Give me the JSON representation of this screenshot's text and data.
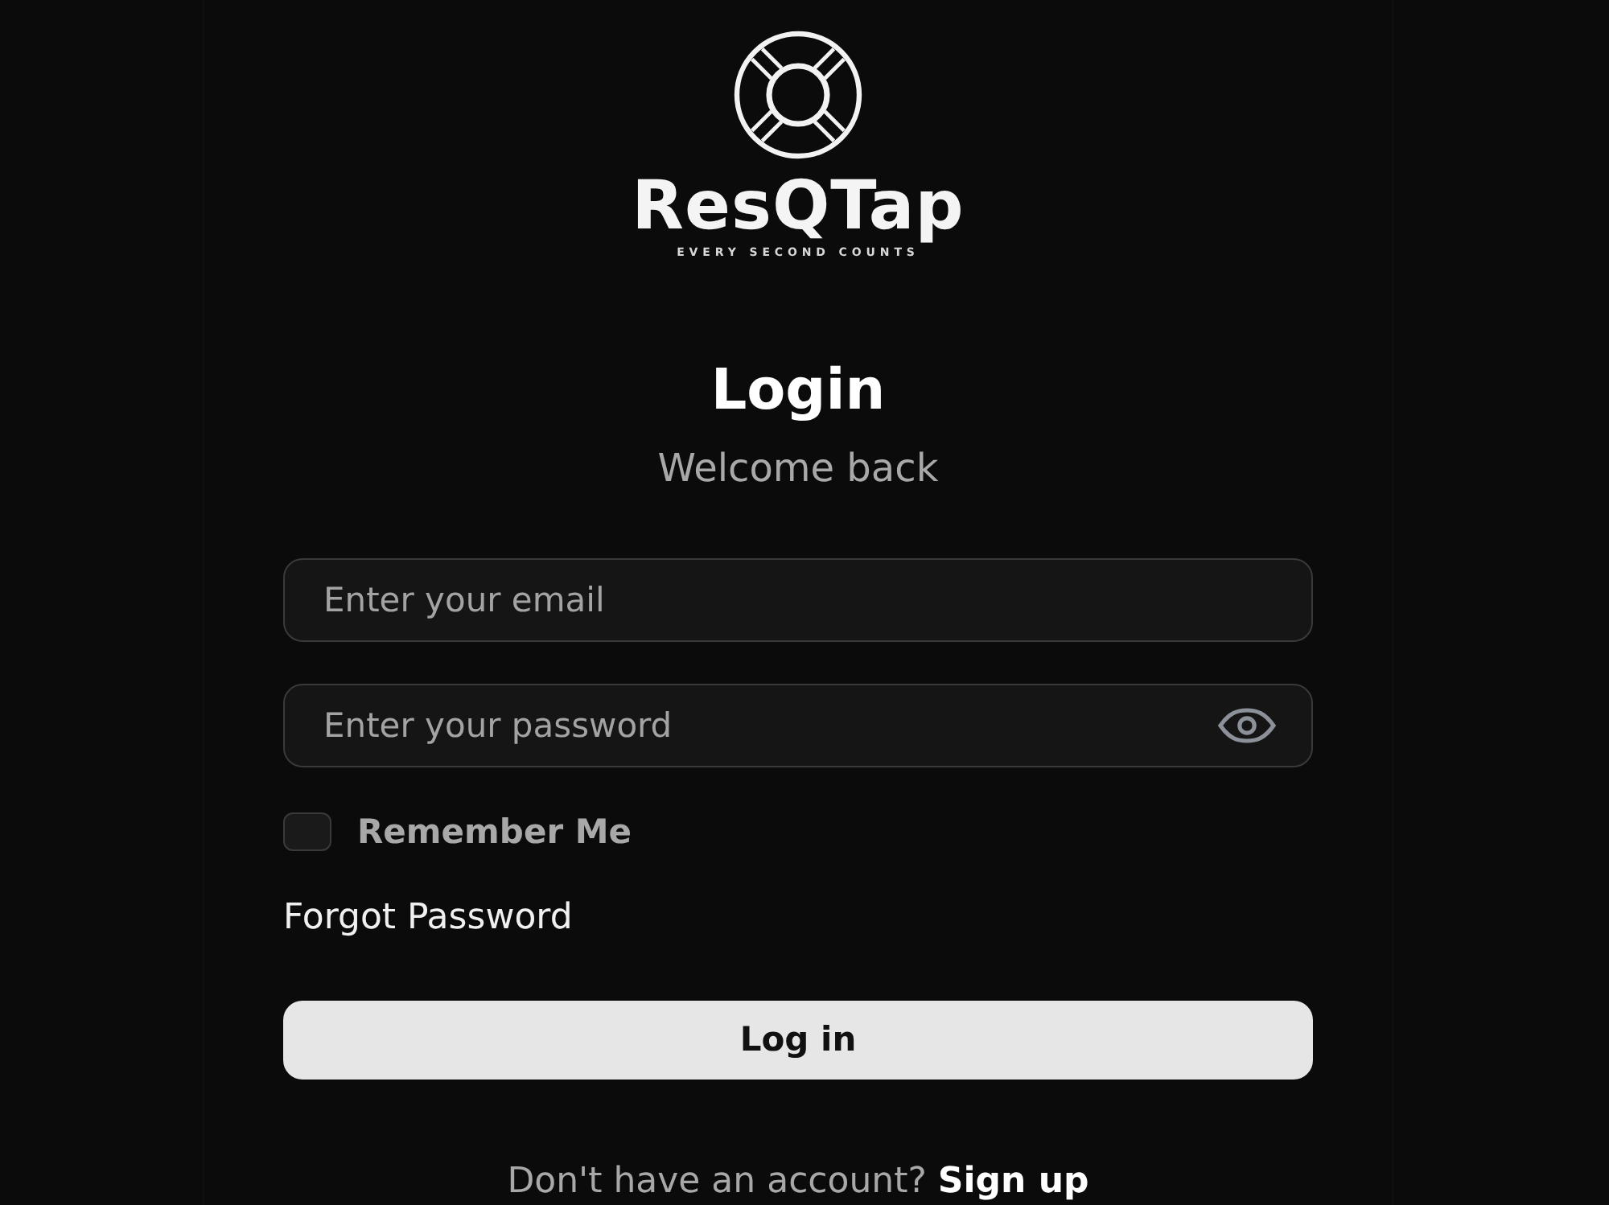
{
  "logo": {
    "name": "ResQTap",
    "tagline": "EVERY SECOND COUNTS"
  },
  "heading": "Login",
  "subheading": "Welcome back",
  "fields": [
    {
      "kind": "email",
      "placeholder": "Enter your email"
    },
    {
      "kind": "password",
      "placeholder": "Enter your password"
    }
  ],
  "remember": {
    "label": "Remember Me",
    "checked": false
  },
  "forgot_link": "Forgot Password",
  "submit": "Log in",
  "footer": {
    "prompt": "Don't have an account?",
    "link": "Sign up"
  }
}
